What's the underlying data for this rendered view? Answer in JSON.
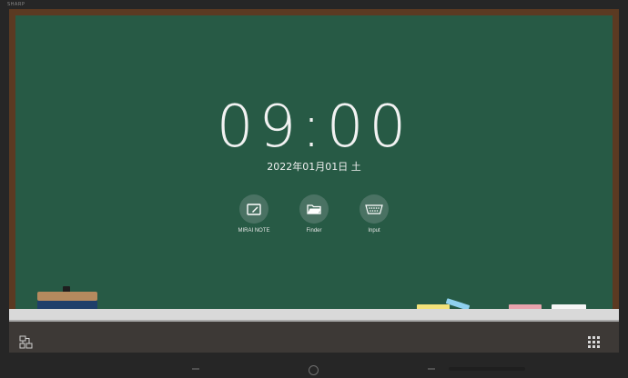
{
  "brand": "SHARP",
  "clock": {
    "time": "09:00",
    "date": "2022年01月01日 土"
  },
  "apps": [
    {
      "label": "MIRAI NOTE",
      "icon": "note-icon"
    },
    {
      "label": "Finder",
      "icon": "folder-icon"
    },
    {
      "label": "Input",
      "icon": "input-port-icon"
    }
  ],
  "taskbar": {
    "left_icon": "network-icon",
    "right_icon": "apps-grid-icon"
  },
  "colors": {
    "board": "#275a45",
    "frame": "#5b3a22",
    "tray": "#d9d9d9",
    "taskbar": "#3d3936"
  },
  "chalks": [
    {
      "name": "yellow",
      "color": "#f3e27a"
    },
    {
      "name": "blue",
      "color": "#8fd1ef"
    },
    {
      "name": "pink",
      "color": "#e8a3ad"
    },
    {
      "name": "white",
      "color": "#f5f5f5"
    }
  ]
}
